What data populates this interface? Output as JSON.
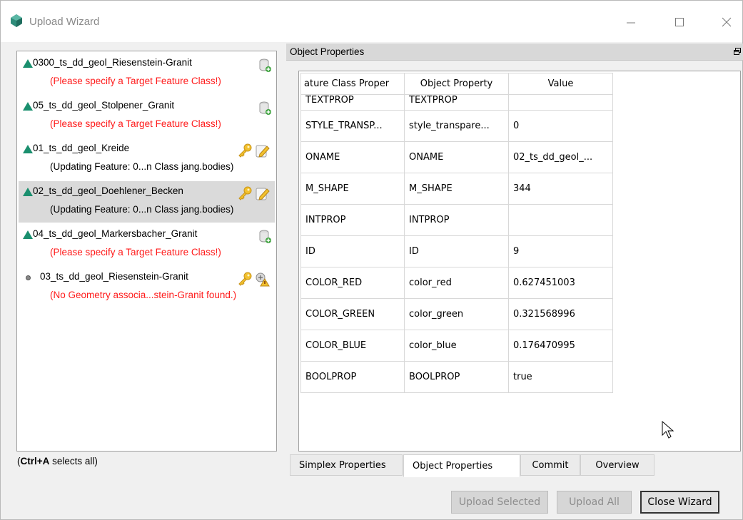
{
  "window": {
    "title": "Upload Wizard",
    "controls": {
      "minimize": "—",
      "maximize": "☐",
      "close": "✕"
    }
  },
  "list": {
    "items": [
      {
        "name": "0300_ts_dd_geol_Riesenstein-Granit",
        "status": "(Please specify a Target Feature Class!)",
        "status_type": "error",
        "marker": "triangle",
        "icons": [
          "database-add-icon"
        ]
      },
      {
        "name": "05_ts_dd_geol_Stolpener_Granit",
        "status": "(Please specify a Target Feature Class!)",
        "status_type": "error",
        "marker": "triangle",
        "icons": [
          "database-add-icon"
        ]
      },
      {
        "name": "01_ts_dd_geol_Kreide",
        "status": "(Updating Feature: 0...n Class jang.bodies)",
        "status_type": "ok",
        "marker": "triangle",
        "icons": [
          "key-icon",
          "edit-icon"
        ]
      },
      {
        "name": "02_ts_dd_geol_Doehlener_Becken",
        "status": "(Updating Feature: 0...n Class jang.bodies)",
        "status_type": "ok",
        "marker": "triangle",
        "selected": true,
        "icons": [
          "key-icon",
          "edit-icon"
        ]
      },
      {
        "name": "04_ts_dd_geol_Markersbacher_Granit",
        "status": "(Please specify a Target Feature Class!)",
        "status_type": "error",
        "marker": "triangle",
        "icons": [
          "database-add-icon"
        ]
      },
      {
        "name": "03_ts_dd_geol_Riesenstein-Granit",
        "status": "(No Geometry associa...stein-Granit found.)",
        "status_type": "error",
        "marker": "dot",
        "icons": [
          "key-icon",
          "warning-link-icon"
        ]
      }
    ]
  },
  "hint": {
    "bold": "Ctrl+A",
    "text": " selects all)",
    "open": "("
  },
  "object_properties": {
    "header": "Object Properties",
    "columns": [
      "ature Class Proper",
      "Object Property",
      "Value"
    ],
    "rows": [
      [
        "TEXTPROP",
        "TEXTPROP",
        ""
      ],
      [
        "STYLE_TRANSP...",
        "style_transpare...",
        "0"
      ],
      [
        "ONAME",
        "ONAME",
        "02_ts_dd_geol_..."
      ],
      [
        "M_SHAPE",
        "M_SHAPE",
        "344"
      ],
      [
        "INTPROP",
        "INTPROP",
        ""
      ],
      [
        "ID",
        "ID",
        "9"
      ],
      [
        "COLOR_RED",
        "color_red",
        "0.627451003"
      ],
      [
        "COLOR_GREEN",
        "color_green",
        "0.321568996"
      ],
      [
        "COLOR_BLUE",
        "color_blue",
        "0.176470995"
      ],
      [
        "BOOLPROP",
        "BOOLPROP",
        "true"
      ]
    ]
  },
  "tabs": [
    {
      "label": "Simplex Properties",
      "active": false
    },
    {
      "label": "Object Properties",
      "active": true
    },
    {
      "label": "Commit",
      "active": false
    },
    {
      "label": "Overview",
      "active": false
    }
  ],
  "buttons": {
    "upload_selected": "Upload Selected",
    "upload_all": "Upload All",
    "close_wizard": "Close Wizard"
  },
  "colors": {
    "triangle": "#1a8f6e",
    "error_text": "#ff1a1a",
    "selection": "#dadada"
  }
}
